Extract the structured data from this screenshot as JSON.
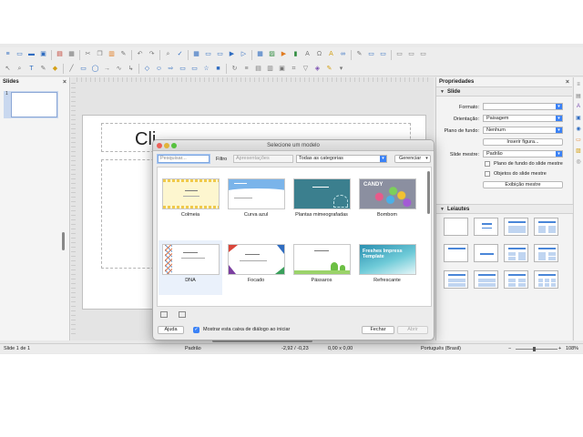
{
  "slides_panel": {
    "title": "Slides",
    "thumb_number": "1"
  },
  "slide": {
    "title_placeholder": "Cli"
  },
  "properties": {
    "title": "Propriedades",
    "section_slide": "Slide",
    "format_label": "Formato:",
    "format_value": "",
    "orientation_label": "Orientação:",
    "orientation_value": "Paisagem",
    "background_label": "Plano de fundo:",
    "background_value": "Nenhum",
    "insert_image_button": "Inserir figura...",
    "master_label": "Slide mestre:",
    "master_value": "Padrão",
    "master_bg_check": "Plano de fundo do slide mestre",
    "master_objects_check": "Objetos do slide mestre",
    "master_view_button": "Exibição mestre",
    "section_layouts": "Leiautes"
  },
  "status": {
    "slide_count": "Slide 1 de 1",
    "master": "Padrão",
    "position": "-2,92 / -0,23",
    "size": "0,00 x 0,00",
    "language": "Português (Brasil)",
    "zoom": "108%"
  },
  "dialog": {
    "title": "Selecione um modelo",
    "search_placeholder": "Pesquisar...",
    "filter_label": "Filtro",
    "filter_value": "Apresentações",
    "category_value": "Todas as categorias",
    "manage_button": "Gerenciar",
    "help_button": "Ajuda",
    "show_dialog_check": "Mostrar esta caixa de diálogo ao iniciar",
    "close_button": "Fechar",
    "open_button": "Abrir",
    "templates": [
      {
        "name": "Colmeia"
      },
      {
        "name": "Curva azul"
      },
      {
        "name": "Plantas mimeografadas"
      },
      {
        "name": "Bombom",
        "thumb_text": "CANDY"
      },
      {
        "name": "DNA"
      },
      {
        "name": "Focado"
      },
      {
        "name": "Pássaros"
      },
      {
        "name": "Refrescante",
        "thumb_text": "Freshes Impress Template"
      }
    ]
  },
  "colors": {
    "accent": "#3b82f6",
    "selection": "#c9d8ef"
  }
}
